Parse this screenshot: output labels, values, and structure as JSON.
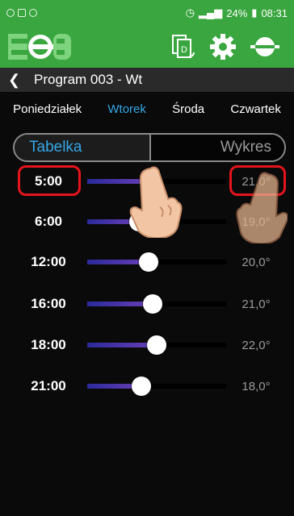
{
  "statusbar": {
    "battery": "24%",
    "time": "08:31"
  },
  "header": {
    "title": "Program 003 - Wt"
  },
  "days": [
    {
      "label": "Poniedziałek",
      "active": false
    },
    {
      "label": "Wtorek",
      "active": true
    },
    {
      "label": "Środa",
      "active": false
    },
    {
      "label": "Czwartek",
      "active": false
    }
  ],
  "tabs": {
    "table": "Tabelka",
    "chart": "Wykres"
  },
  "schedule": [
    {
      "time": "5:00",
      "temp": "21,0°",
      "level": 0.45
    },
    {
      "time": "6:00",
      "temp": "19,0°",
      "level": 0.37
    },
    {
      "time": "12:00",
      "temp": "20,0°",
      "level": 0.44
    },
    {
      "time": "16:00",
      "temp": "21,0°",
      "level": 0.47
    },
    {
      "time": "18:00",
      "temp": "22,0°",
      "level": 0.5
    },
    {
      "time": "21:00",
      "temp": "18,0°",
      "level": 0.39
    }
  ],
  "colors": {
    "brand": "#3aa63f",
    "accent": "#35a7e8",
    "highlight": "#e5141c"
  },
  "icons": [
    "copy-schedule-icon",
    "settings-gear-icon",
    "thermostat-icon",
    "back-arrow-icon"
  ]
}
